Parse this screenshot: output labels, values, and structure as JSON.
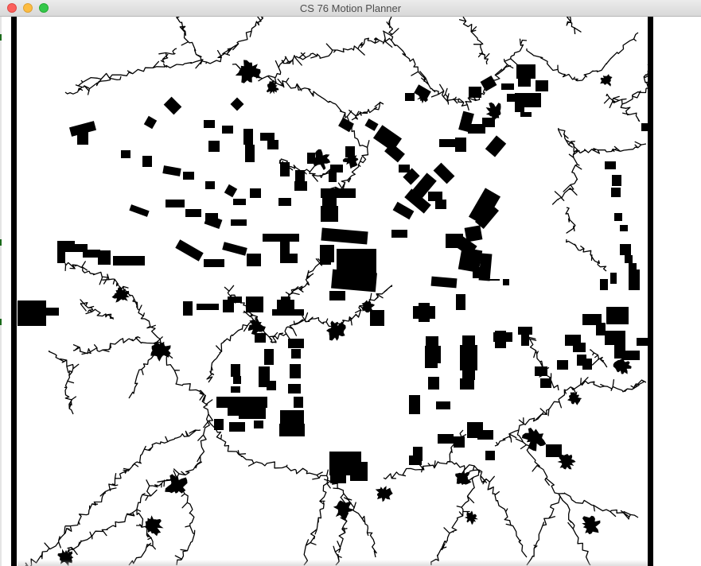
{
  "window": {
    "title": "CS 76 Motion Planner",
    "controls": [
      "close",
      "minimize",
      "maximize"
    ]
  },
  "canvas": {
    "background": "#ffffff",
    "obstacle_color": "#000000",
    "tree_color": "#000000"
  },
  "colors": {
    "close": "#fc605c",
    "minimize": "#fdbc40",
    "maximize": "#34c84a"
  }
}
